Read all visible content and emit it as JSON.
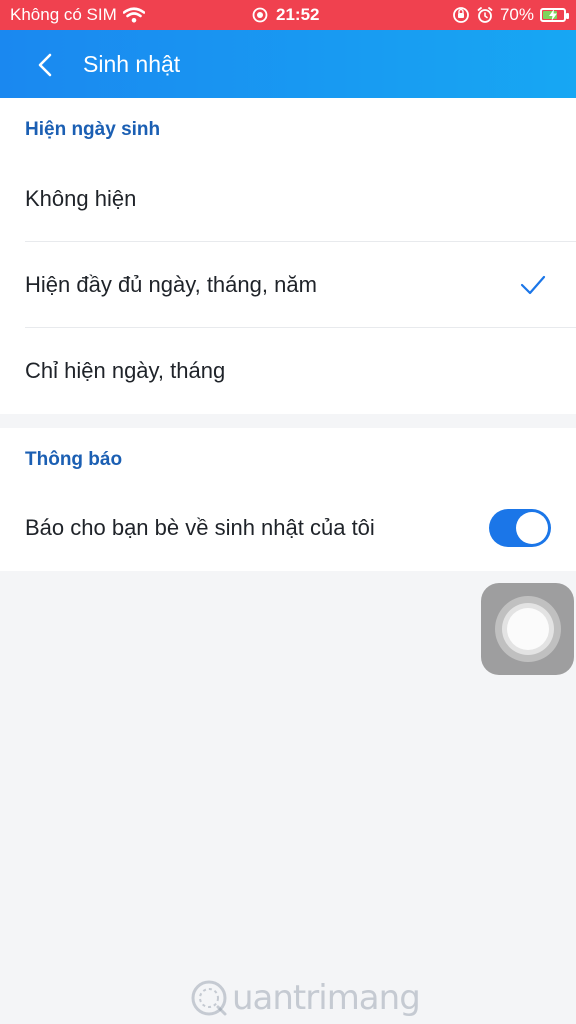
{
  "status_bar": {
    "carrier": "Không có SIM",
    "time": "21:52",
    "battery_percent": "70%",
    "battery_level": 0.7,
    "background_color": "#f0414f"
  },
  "header": {
    "title": "Sinh nhật",
    "back_icon": "chevron-left-icon",
    "gradient": [
      "#1a88f0",
      "#17a7f3"
    ]
  },
  "birthday_display": {
    "section_title": "Hiện ngày sinh",
    "options": [
      {
        "label": "Không hiện",
        "selected": false
      },
      {
        "label": "Hiện đầy đủ ngày, tháng, năm",
        "selected": true
      },
      {
        "label": "Chỉ hiện ngày, tháng",
        "selected": false
      }
    ]
  },
  "notifications": {
    "section_title": "Thông báo",
    "toggle_label": "Báo cho bạn bè về sinh nhật của tôi",
    "toggle_on": true,
    "accent_color": "#1b76e8"
  },
  "watermark": {
    "text": "uantrimang"
  }
}
